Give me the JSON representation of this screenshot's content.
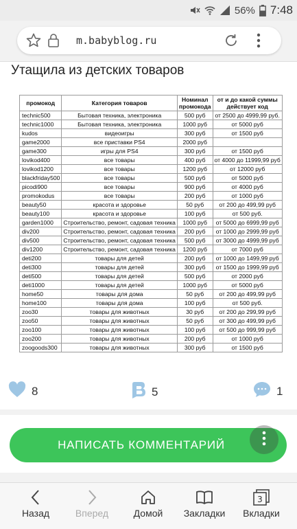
{
  "status": {
    "battery": "56%",
    "time": "7:48"
  },
  "browser": {
    "url": "m.babyblog.ru"
  },
  "post": {
    "title": "Утащила из детских товаров"
  },
  "table": {
    "headers": [
      "промокод",
      "Категория товаров",
      "Номинал промокода",
      "от и до какой суммы действует код"
    ],
    "rows": [
      [
        "technic500",
        "Бытовая техника, электроника",
        "500 руб",
        "от 2500 до 4999,99 руб."
      ],
      [
        "technic1000",
        "Бытовая техника, электроника",
        "1000 руб",
        "от 5000 руб"
      ],
      [
        "kudos",
        "видеоигры",
        "300 руб",
        "от 1500 руб"
      ],
      [
        "game2000",
        "все приставки PS4",
        "2000 руб",
        ""
      ],
      [
        "game300",
        "игры для PS4",
        "300 руб",
        "от 1500 руб"
      ],
      [
        "lovikod400",
        "все товары",
        "400 руб",
        "от 4000 до 11999,99 руб"
      ],
      [
        "lovikod1200",
        "все товары",
        "1200 руб",
        "от 12000 руб"
      ],
      [
        "blackfriday500",
        "все товары",
        "500 руб",
        "от 5000 руб"
      ],
      [
        "picodi900",
        "все товары",
        "900 руб",
        "от 4000 руб"
      ],
      [
        "promokodus",
        "все товары",
        "200 руб",
        "от 1000 руб"
      ],
      [
        "beauty50",
        "красота и здоровье",
        "50 руб",
        "от 200 до 499,99 руб"
      ],
      [
        "beauty100",
        "красота и здоровье",
        "100 руб",
        "от 500 руб."
      ],
      [
        "garden1000",
        "Строительство, ремонт, садовая техника",
        "1000 руб",
        "от 5000 до 6999,99 руб"
      ],
      [
        "div200",
        "Строительство, ремонт, садовая техника",
        "200 руб",
        "от 1000 до 2999,99 руб"
      ],
      [
        "div500",
        "Строительство, ремонт, садовая техника",
        "500 руб",
        "от 3000 до 4999,99 руб"
      ],
      [
        "div1200",
        "Строительство, ремонт, садовая техника",
        "1200 руб",
        "от 7000 руб"
      ],
      [
        "deti200",
        "товары для детей",
        "200 руб",
        "от 1000 до 1499,99 руб"
      ],
      [
        "deti300",
        "товары для детей",
        "300 руб",
        "от 1500 до 1999,99 руб"
      ],
      [
        "deti500",
        "товары для детей",
        "500 руб",
        "от 2000 руб"
      ],
      [
        "deti1000",
        "товары для детей",
        "1000 руб",
        "от 5000 руб"
      ],
      [
        "home50",
        "товары для дома",
        "50 руб",
        "от 200 до 499,99 руб"
      ],
      [
        "home100",
        "товары для дома",
        "100 руб",
        "от 500 руб."
      ],
      [
        "zoo30",
        "товары для животных",
        "30 руб",
        "от 200 до 299,99 руб"
      ],
      [
        "zoo50",
        "товары для животных",
        "50 руб",
        "от 300 до 499,99 руб"
      ],
      [
        "zoo100",
        "товары для животных",
        "100 руб",
        "от 500 до 999,99 руб"
      ],
      [
        "zoo200",
        "товары для животных",
        "200 руб",
        "от 1000 руб"
      ],
      [
        "zoogoods300",
        "товары для животных",
        "300 руб",
        "от 1500 руб"
      ]
    ]
  },
  "reactions": {
    "likes": "8",
    "bookmarks": "5",
    "comments": "1"
  },
  "comment_button": {
    "label": "НАПИСАТЬ КОММЕНТАРИЙ"
  },
  "nav": {
    "back": "Назад",
    "forward": "Вперед",
    "home": "Домой",
    "bookmarks": "Закладки",
    "tabs": "Вкладки",
    "tabs_count": "3"
  },
  "colors": {
    "accent": "#3dc55a",
    "icon": "#9ec6e4"
  }
}
